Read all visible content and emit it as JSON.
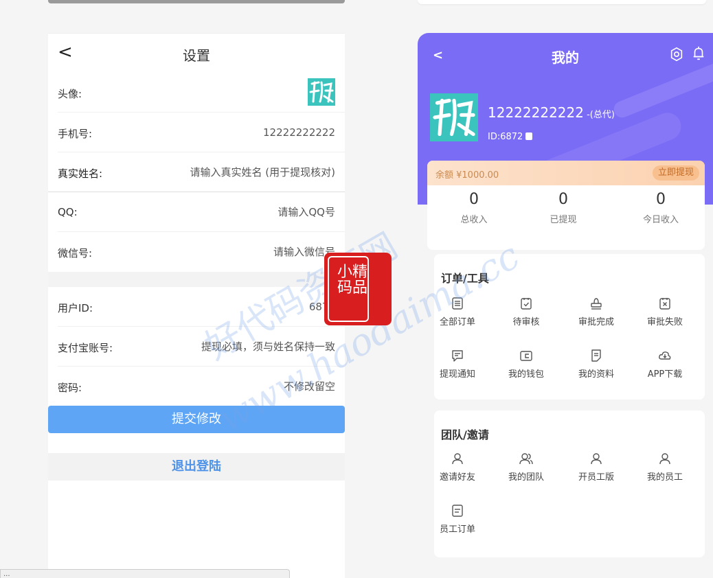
{
  "settings": {
    "title": "设置",
    "back_symbol": "<",
    "rows": {
      "avatar_label": "头像:",
      "phone_label": "手机号:",
      "phone_value": "12222222222",
      "realname_label": "真实姓名:",
      "realname_placeholder": "请输入真实姓名 (用于提现核对)",
      "qq_label": "QQ:",
      "qq_placeholder": "请输入QQ号",
      "wechat_label": "微信号:",
      "wechat_placeholder": "请输入微信号",
      "userid_label": "用户ID:",
      "userid_value": "6872",
      "alipay_label": "支付宝账号:",
      "alipay_placeholder": "提现必填，须与姓名保持一致",
      "password_label": "密码:",
      "password_placeholder": "不修改留空"
    },
    "submit_label": "提交修改",
    "logout_label": "退出登陆"
  },
  "url_bar": "...",
  "profile": {
    "back_symbol": "<",
    "title": "我的",
    "username": "12222222222",
    "role": " -(总代)",
    "id_text": "ID:6872",
    "balance_text": "余额 ¥1000.00",
    "withdraw_label": "立即提现",
    "stats": [
      {
        "num": "0",
        "label": "总收入"
      },
      {
        "num": "0",
        "label": "已提现"
      },
      {
        "num": "0",
        "label": "今日收入"
      }
    ],
    "orders_title": "订单/工具",
    "orders_items": [
      {
        "label": "全部订单",
        "icon": "list-icon"
      },
      {
        "label": "待审核",
        "icon": "check-doc-icon"
      },
      {
        "label": "审批完成",
        "icon": "stamp-icon"
      },
      {
        "label": "审批失败",
        "icon": "x-doc-icon"
      },
      {
        "label": "提现通知",
        "icon": "message-icon"
      },
      {
        "label": "我的钱包",
        "icon": "wallet-icon"
      },
      {
        "label": "我的资料",
        "icon": "document-icon"
      },
      {
        "label": "APP下载",
        "icon": "cloud-download-icon"
      }
    ],
    "team_title": "团队/邀请",
    "team_items": [
      {
        "label": "邀请好友",
        "icon": "user-icon"
      },
      {
        "label": "我的团队",
        "icon": "users-icon"
      },
      {
        "label": "开员工版",
        "icon": "user-icon"
      },
      {
        "label": "我的员工",
        "icon": "user-icon"
      },
      {
        "label": "员工订单",
        "icon": "list-icon"
      }
    ]
  },
  "watermark": {
    "line1": "好代码资源网",
    "line2": "www.haodaima.cc",
    "seal": "小精码品"
  },
  "colors": {
    "primary": "#7b6cf6",
    "avatar": "#3bc3bd",
    "submit": "#5ea5f5",
    "logout_text": "#4f93e8",
    "seal": "#d81e1e"
  }
}
